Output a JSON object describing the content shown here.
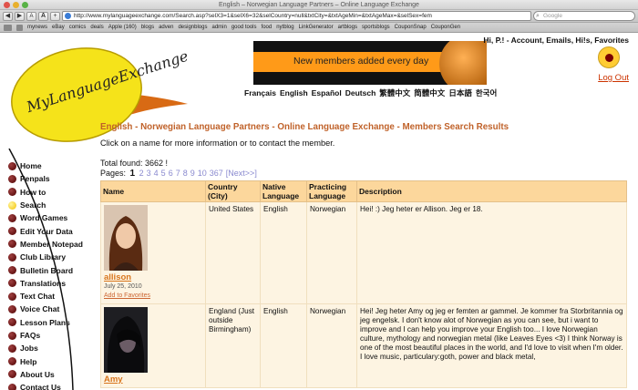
{
  "browser": {
    "title": "English – Norwegian Language Partners – Online Language Exchange",
    "url": "http://www.mylanguageexchange.com/Search.asp?selX3=1&selX6=32&selCountry=null&txtCity=&txtAgeMin=&txtAgeMax=&selSex=fem",
    "search_placeholder": "Google",
    "bookmarks": [
      "mynews",
      "eBay",
      "comics",
      "deals",
      "Apple (160)",
      "blogs",
      "adven",
      "designblogs",
      "admin",
      "good tools",
      "food",
      "nytblog",
      "LinkGenerator",
      "artblogs",
      "sportsblogs",
      "CouponSnap",
      "CouponGen"
    ]
  },
  "site": {
    "logo_text": "MyLanguageExchange.com",
    "account_text": "Hi, P.! - Account, Emails, Hi!s, Favorites",
    "logout": "Log Out",
    "banner_text": "New members added every day",
    "languages": [
      "Français",
      "English",
      "Español",
      "Deutsch",
      "繁體中文",
      "简體中文",
      "日本語",
      "한국어"
    ]
  },
  "nav": {
    "items": [
      "Home",
      "Penpals",
      "How to",
      "Search",
      "Word Games",
      "Edit Your Data",
      "Member Notepad",
      "Club Library",
      "Bulletin Board",
      "Translations",
      "Text Chat",
      "Voice Chat",
      "Lesson Plans",
      "FAQs",
      "Jobs",
      "Help",
      "About Us",
      "Contact Us"
    ],
    "active_index": 3
  },
  "main": {
    "heading": "English - Norwegian Language Partners - Online Language Exchange - Members Search Results",
    "subtext": "Click on a name for more information or to contact the member.",
    "total": "Total found: 3662 !",
    "pages_label": "Pages:",
    "current_page": "1",
    "page_links": [
      "2",
      "3",
      "4",
      "5",
      "6",
      "7",
      "8",
      "9",
      "10",
      "367"
    ],
    "next_label": "[Next>>]",
    "columns": [
      "Name",
      "Country (City)",
      "Native Language",
      "Practicing Language",
      "Description"
    ],
    "rows": [
      {
        "name": "allison",
        "date": "July 25, 2010",
        "add_fav": "Add to Favorites",
        "country": "United States",
        "native": "English",
        "practicing": "Norwegian",
        "description": "Hei! :) Jeg heter er Allison. Jeg er 18."
      },
      {
        "name": "Amy",
        "date": "",
        "add_fav": "",
        "country": "England (Just outside Birmingham)",
        "native": "English",
        "practicing": "Norwegian",
        "description": "Hei! Jeg heter Amy og jeg er femten ar gammel. Je kommer fra Storbritannia og jeg engelsk. I don't know alot of Norwegian as you can see, but i want to improve and I can help you improve your English too... I love Norwegian culture, mythology and norwegian metal (like Leaves Eyes <3) I think Norway is one of the most beautiful places in the world, and I'd love to visit when I'm older. I love music, particulary:goth, power and black metal,"
      }
    ]
  },
  "colors": {
    "accent_orange": "#c0622a",
    "header_bg": "#fcd79c",
    "row_bg": "#fdf4e2",
    "logo_yellow": "#f5e31a"
  }
}
